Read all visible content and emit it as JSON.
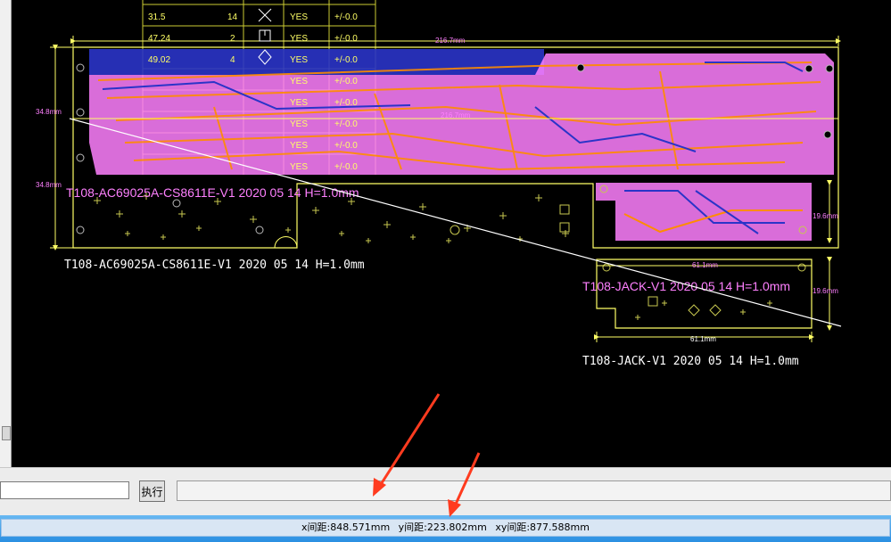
{
  "colors": {
    "background": "#000000",
    "outline": "#ffff66",
    "copper_top": "#ff8c00",
    "copper_bottom": "#2a34c8",
    "silkscreen": "#ff80ff",
    "measure_line": "#ffffff",
    "annotation_arrow": "#ff3b1f"
  },
  "board_main": {
    "silk_label": "T108-AC69025A-CS8611E-V1   2020 05 14   H=1.0mm",
    "label": "T108-AC69025A-CS8611E-V1   2020 05 14   H=1.0mm",
    "dim_width": "216.7mm",
    "dim_width_inner": "216.7mm",
    "dim_height_top": "34.8mm",
    "dim_height_bottom": "34.8mm"
  },
  "board_jack": {
    "silk_label": "T108-JACK-V1  2020 05 14  H=1.0mm",
    "label": "T108-JACK-V1  2020 05 14  H=1.0mm",
    "dim_width": "61.1mm",
    "dim_width_top": "61.1mm",
    "dim_height_top": "19.6mm",
    "dim_height_bottom": "19.6mm"
  },
  "drill_table": {
    "rows": [
      {
        "size": "31.5",
        "count": "14",
        "plated": "YES",
        "tol": "+/-0.0"
      },
      {
        "size": "47.24",
        "count": "2",
        "plated": "YES",
        "tol": "+/-0.0"
      },
      {
        "size": "49.02",
        "count": "4",
        "plated": "YES",
        "tol": "+/-0.0"
      },
      {
        "size": "",
        "count": "",
        "plated": "YES",
        "tol": "+/-0.0"
      },
      {
        "size": "",
        "count": "",
        "plated": "YES",
        "tol": "+/-0.0"
      },
      {
        "size": "",
        "count": "",
        "plated": "YES",
        "tol": "+/-0.0"
      },
      {
        "size": "",
        "count": "",
        "plated": "YES",
        "tol": "+/-0.0"
      },
      {
        "size": "",
        "count": "",
        "plated": "YES",
        "tol": "+/-0.0"
      }
    ]
  },
  "command_bar": {
    "input_value": "",
    "execute_label": "执行",
    "message": ""
  },
  "status_bar": {
    "x_distance": "x间距:848.571mm",
    "y_distance": "y间距:223.802mm",
    "xy_distance": "xy间距:877.588mm"
  }
}
